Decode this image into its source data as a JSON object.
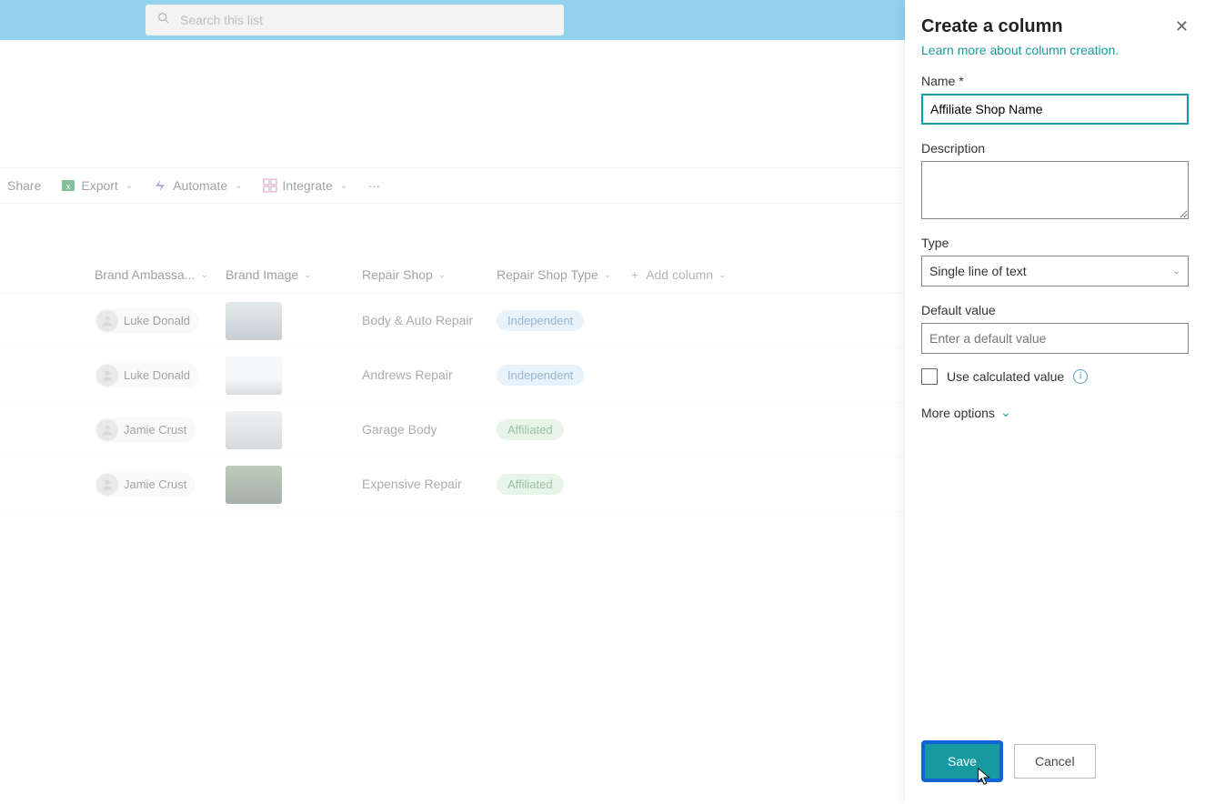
{
  "topbar": {
    "search_placeholder": "Search this list"
  },
  "toolbar": {
    "share": "Share",
    "export": "Export",
    "automate": "Automate",
    "integrate": "Integrate"
  },
  "columns": {
    "brand_ambassador": "Brand Ambassa...",
    "brand_image": "Brand Image",
    "repair_shop": "Repair Shop",
    "repair_shop_type": "Repair Shop Type",
    "add_column": "Add column"
  },
  "rows": [
    {
      "person": "Luke Donald",
      "shop": "Body & Auto Repair",
      "type": "Independent",
      "type_class": "ind"
    },
    {
      "person": "Luke Donald",
      "shop": "Andrews Repair",
      "type": "Independent",
      "type_class": "ind"
    },
    {
      "person": "Jamie Crust",
      "shop": "Garage Body",
      "type": "Affiliated",
      "type_class": "aff"
    },
    {
      "person": "Jamie Crust",
      "shop": "Expensive Repair",
      "type": "Affiliated",
      "type_class": "aff"
    }
  ],
  "panel": {
    "title": "Create a column",
    "help_link": "Learn more about column creation.",
    "name_label": "Name *",
    "name_value": "Affiliate Shop Name",
    "description_label": "Description",
    "description_value": "",
    "type_label": "Type",
    "type_value": "Single line of text",
    "default_label": "Default value",
    "default_placeholder": "Enter a default value",
    "calc_label": "Use calculated value",
    "more_options": "More options",
    "save": "Save",
    "cancel": "Cancel"
  }
}
